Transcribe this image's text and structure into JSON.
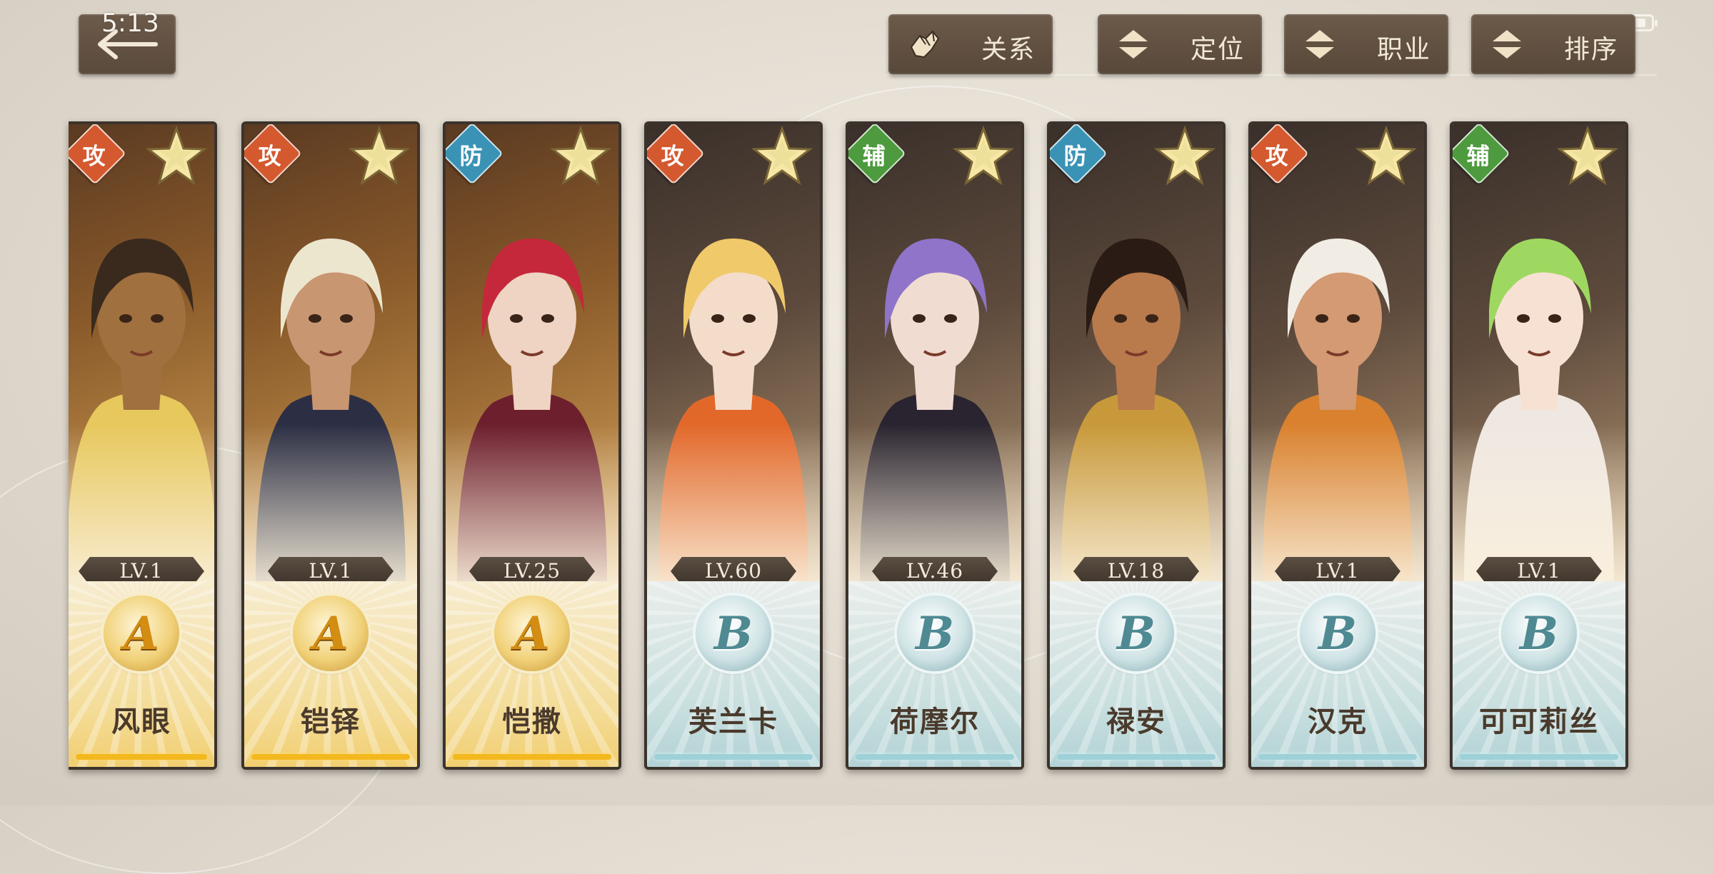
{
  "status_bar": {
    "time": "5:13",
    "battery_level": 0.8
  },
  "toolbar": {
    "back_icon": "back-arrow-icon",
    "buttons": [
      {
        "label": "关系",
        "icon": "relationship-hands-icon"
      },
      {
        "label": "定位",
        "icon": "sort-updown-icon"
      },
      {
        "label": "职业",
        "icon": "sort-updown-icon"
      },
      {
        "label": "排序",
        "icon": "sort-updown-icon"
      }
    ]
  },
  "role_colors": {
    "攻": "#d4592f",
    "防": "#3a93b5",
    "辅": "#4e9a3e"
  },
  "rank_colors": {
    "A": "#d38d12",
    "B": "#4f8a93"
  },
  "characters": [
    {
      "name": "风眼",
      "role": "攻",
      "level": "LV.1",
      "rank": "A",
      "theme": "gold",
      "hair": "#3a2a1e",
      "outfit": "#e7c85d",
      "skin": "#a0703f"
    },
    {
      "name": "铠铎",
      "role": "攻",
      "level": "LV.1",
      "rank": "A",
      "theme": "gold",
      "hair": "#ece6cf",
      "outfit": "#2c2f44",
      "skin": "#c99672"
    },
    {
      "name": "恺撒",
      "role": "防",
      "level": "LV.25",
      "rank": "A",
      "theme": "gold",
      "hair": "#c4283a",
      "outfit": "#6d1f2e",
      "skin": "#efd3c3"
    },
    {
      "name": "芙兰卡",
      "role": "攻",
      "level": "LV.60",
      "rank": "B",
      "theme": "teal",
      "hair": "#f0c96a",
      "outfit": "#e2682a",
      "skin": "#f4dccb"
    },
    {
      "name": "荷摩尔",
      "role": "辅",
      "level": "LV.46",
      "rank": "B",
      "theme": "teal",
      "hair": "#8f74c9",
      "outfit": "#2a2430",
      "skin": "#f1dcd2"
    },
    {
      "name": "禄安",
      "role": "防",
      "level": "LV.18",
      "rank": "B",
      "theme": "teal",
      "hair": "#2a1c14",
      "outfit": "#c8993a",
      "skin": "#b97a4c"
    },
    {
      "name": "汉克",
      "role": "攻",
      "level": "LV.1",
      "rank": "B",
      "theme": "teal",
      "hair": "#f1ede4",
      "outfit": "#d9812e",
      "skin": "#d39a73"
    },
    {
      "name": "可可莉丝",
      "role": "辅",
      "level": "LV.1",
      "rank": "B",
      "theme": "teal",
      "hair": "#9fd860",
      "outfit": "#efe8e2",
      "skin": "#f6e1d3"
    }
  ]
}
